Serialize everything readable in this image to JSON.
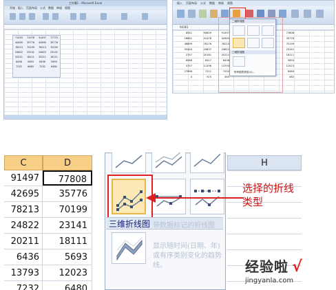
{
  "top_left": {
    "title": "工作簿1 - Microsoft Excel",
    "tabs": [
      "开始",
      "插入",
      "页面布局",
      "公式",
      "数据",
      "审阅",
      "视图"
    ],
    "rows": [
      [
        "71493",
        "71976",
        "91497",
        "77775"
      ],
      [
        "42695",
        "35776",
        "42695",
        "35776"
      ],
      [
        "78213",
        "70199",
        "78213",
        "70199"
      ],
      [
        "24822",
        "23141",
        "24822",
        "23141"
      ],
      [
        "20211",
        "18111",
        "20211",
        "18111"
      ],
      [
        "6436",
        "5693",
        "6436",
        "5693"
      ],
      [
        "7232",
        "6480",
        "7232",
        "6480"
      ]
    ]
  },
  "top_right": {
    "tabs": [
      "插入",
      "页面布局",
      "公式",
      "数据",
      "审阅",
      "视图"
    ],
    "formula_bar": "94361",
    "menu_title": "二维折线图",
    "menu_section": "三维折线图",
    "menu_link": "所有图表类型(A)...",
    "col1": [
      "8541",
      "16661",
      "46899",
      "55444",
      "2757",
      "8586",
      "3757",
      "27866",
      "4"
    ],
    "col2": [
      "90809",
      "41478",
      "78176",
      "24837",
      "20181",
      "6417",
      "11296",
      "7211",
      "515"
    ],
    "col3": [
      "91497",
      "42695",
      "78213",
      "24822",
      "20211",
      "6436",
      "13793",
      "7232",
      "464"
    ],
    "col4": [
      "77808",
      "35776",
      "70199",
      "23141",
      "18111",
      "5693",
      "12023",
      "6480",
      "462"
    ]
  },
  "zoom": {
    "col_headers": {
      "c": "C",
      "d": "D",
      "h": "H"
    },
    "rows": [
      {
        "c": "91497",
        "d": "77808"
      },
      {
        "c": "42695",
        "d": "35776"
      },
      {
        "c": "78213",
        "d": "70199"
      },
      {
        "c": "24822",
        "d": "23141"
      },
      {
        "c": "20211",
        "d": "18111"
      },
      {
        "c": "6436",
        "d": "5693"
      },
      {
        "c": "13793",
        "d": "12023"
      },
      {
        "c": "7232",
        "d": "6480"
      }
    ],
    "section_3d": "三维折线图",
    "ghost_text_1": "带数据标记的折线图",
    "ghost_text_2": "显示随时间(日期、年)或有序类别变化的趋势线。",
    "callout": "选择的折线类型",
    "selected_chart": "line-with-markers-icon"
  },
  "watermark": {
    "main": "经验啦",
    "check": "√",
    "url": "jingyanla.com"
  },
  "colors": {
    "accent_red": "#e02020",
    "header_blue": "#dbe5f1",
    "selected_orange": "#f7cf86"
  }
}
